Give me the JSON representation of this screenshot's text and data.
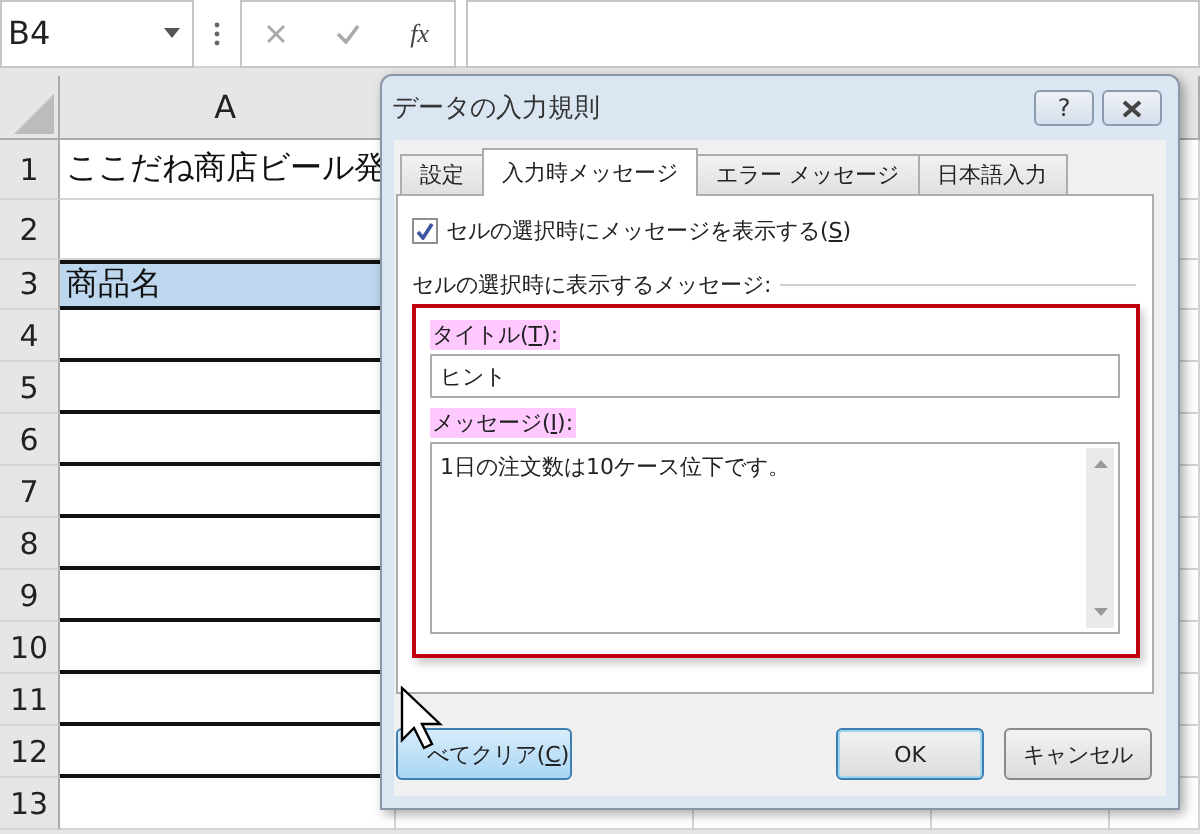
{
  "formula_bar": {
    "name_box": "B4",
    "function_label": "fx"
  },
  "columns": [
    {
      "label": "A"
    }
  ],
  "rows": [
    {
      "number": "1",
      "kind": "title",
      "cell": "ここだね商店ビール発"
    },
    {
      "number": "2",
      "kind": "blank"
    },
    {
      "number": "3",
      "kind": "header",
      "cell": "商品名"
    },
    {
      "number": "4",
      "kind": "table"
    },
    {
      "number": "5",
      "kind": "table"
    },
    {
      "number": "6",
      "kind": "table"
    },
    {
      "number": "7",
      "kind": "table"
    },
    {
      "number": "8",
      "kind": "table"
    },
    {
      "number": "9",
      "kind": "table"
    },
    {
      "number": "10",
      "kind": "table"
    },
    {
      "number": "11",
      "kind": "table"
    },
    {
      "number": "12",
      "kind": "table"
    },
    {
      "number": "13",
      "kind": "blank"
    }
  ],
  "dialog": {
    "title": "データの入力規則",
    "help_button": "?",
    "tabs": [
      {
        "label": "設定",
        "selected": false
      },
      {
        "label": "入力時メッセージ",
        "selected": true
      },
      {
        "label": "エラー メッセージ",
        "selected": false
      },
      {
        "label": "日本語入力",
        "selected": false
      }
    ],
    "show_checkbox": {
      "label": "セルの選択時にメッセージを表示する(",
      "accel": "S",
      "tail": ")",
      "checked": true
    },
    "group_label": "セルの選択時に表示するメッセージ:",
    "title_field": {
      "label": "タイトル(",
      "accel": "T",
      "tail": "):",
      "highlighted": true,
      "value": "ヒント"
    },
    "message_field": {
      "label": "メッセージ(",
      "accel": "I",
      "tail": "):",
      "highlighted": true,
      "value": "1日の注文数は10ケース位下です。"
    },
    "buttons": [
      {
        "kind": "clear",
        "label": "べてクリア(",
        "accel": "C",
        "tail": ")"
      },
      {
        "kind": "default",
        "label": "OK"
      },
      {
        "kind": "normal",
        "label": "キャンセル"
      }
    ]
  }
}
